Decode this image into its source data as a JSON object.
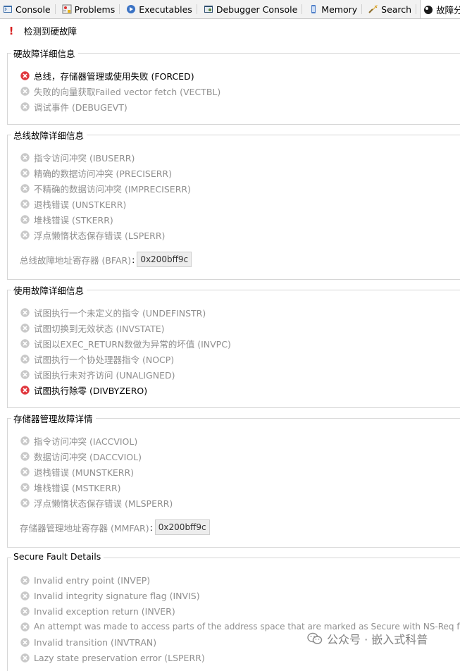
{
  "tabs": [
    {
      "label": "Console",
      "icon": "console-icon",
      "active": false
    },
    {
      "label": "Problems",
      "icon": "problems-icon",
      "active": false
    },
    {
      "label": "Executables",
      "icon": "executables-icon",
      "active": false
    },
    {
      "label": "Debugger Console",
      "icon": "debugger-console-icon",
      "active": false
    },
    {
      "label": "Memory",
      "icon": "memory-icon",
      "active": false
    },
    {
      "label": "Search",
      "icon": "search-icon",
      "active": false
    },
    {
      "label": "故障分析器",
      "icon": "fault-analyzer-icon",
      "active": true
    }
  ],
  "alert": {
    "text": "检测到硬故障"
  },
  "groups": {
    "hard_fault": {
      "title": "硬故障详细信息",
      "items": [
        {
          "label": "总线，存储器管理或使用失败 (FORCED)",
          "active": true
        },
        {
          "label": "失败的向量获取Failed vector fetch (VECTBL)",
          "active": false
        },
        {
          "label": "调试事件 (DEBUGEVT)",
          "active": false
        }
      ]
    },
    "bus_fault": {
      "title": "总线故障详细信息",
      "items": [
        {
          "label": "指令访问冲突 (IBUSERR)",
          "active": false
        },
        {
          "label": "精确的数据访问冲突 (PRECISERR)",
          "active": false
        },
        {
          "label": "不精确的数据访问冲突 (IMPRECISERR)",
          "active": false
        },
        {
          "label": "退栈错误 (UNSTKERR)",
          "active": false
        },
        {
          "label": "堆栈错误 (STKERR)",
          "active": false
        },
        {
          "label": "浮点懒惰状态保存错误 (LSPERR)",
          "active": false
        }
      ],
      "address_label": "总线故障地址寄存器 (BFAR)",
      "address_value": "0x200bff9c"
    },
    "usage_fault": {
      "title": "使用故障详细信息",
      "items": [
        {
          "label": "试图执行一个未定义的指令 (UNDEFINSTR)",
          "active": false
        },
        {
          "label": "试图切换到无效状态 (INVSTATE)",
          "active": false
        },
        {
          "label": "试图以EXEC_RETURN数做为异常的坏值 (INVPC)",
          "active": false
        },
        {
          "label": "试图执行一个协处理器指令 (NOCP)",
          "active": false
        },
        {
          "label": "试图执行未对齐访问 (UNALIGNED)",
          "active": false
        },
        {
          "label": "试图执行除零 (DIVBYZERO)",
          "active": true
        }
      ]
    },
    "mem_fault": {
      "title": "存储器管理故障详情",
      "items": [
        {
          "label": "指令访问冲突 (IACCVIOL)",
          "active": false
        },
        {
          "label": "数据访问冲突 (DACCVIOL)",
          "active": false
        },
        {
          "label": "退栈错误 (MUNSTKERR)",
          "active": false
        },
        {
          "label": "堆栈错误 (MSTKERR)",
          "active": false
        },
        {
          "label": "浮点懒惰状态保存错误 (MLSPERR)",
          "active": false
        }
      ],
      "address_label": "存储器管理地址寄存器 (MMFAR)",
      "address_value": "0x200bff9c"
    },
    "secure_fault": {
      "title": "Secure Fault Details",
      "items": [
        {
          "label": "Invalid entry point (INVEP)",
          "active": false
        },
        {
          "label": "Invalid integrity signature flag (INVIS)",
          "active": false
        },
        {
          "label": "Invalid exception return (INVER)",
          "active": false
        },
        {
          "label": "An attempt was made to access parts of the address space that are marked as Secure with NS-Req for",
          "active": false
        },
        {
          "label": "Invalid transition (INVTRAN)",
          "active": false
        },
        {
          "label": "Lazy state preservation error (LSPERR)",
          "active": false
        }
      ]
    }
  },
  "watermark": {
    "text": "公众号 · 嵌入式科普"
  },
  "colors": {
    "active_error": "#e0383e",
    "inactive_error": "#c9c9c9",
    "alert": "#d71f1f"
  }
}
